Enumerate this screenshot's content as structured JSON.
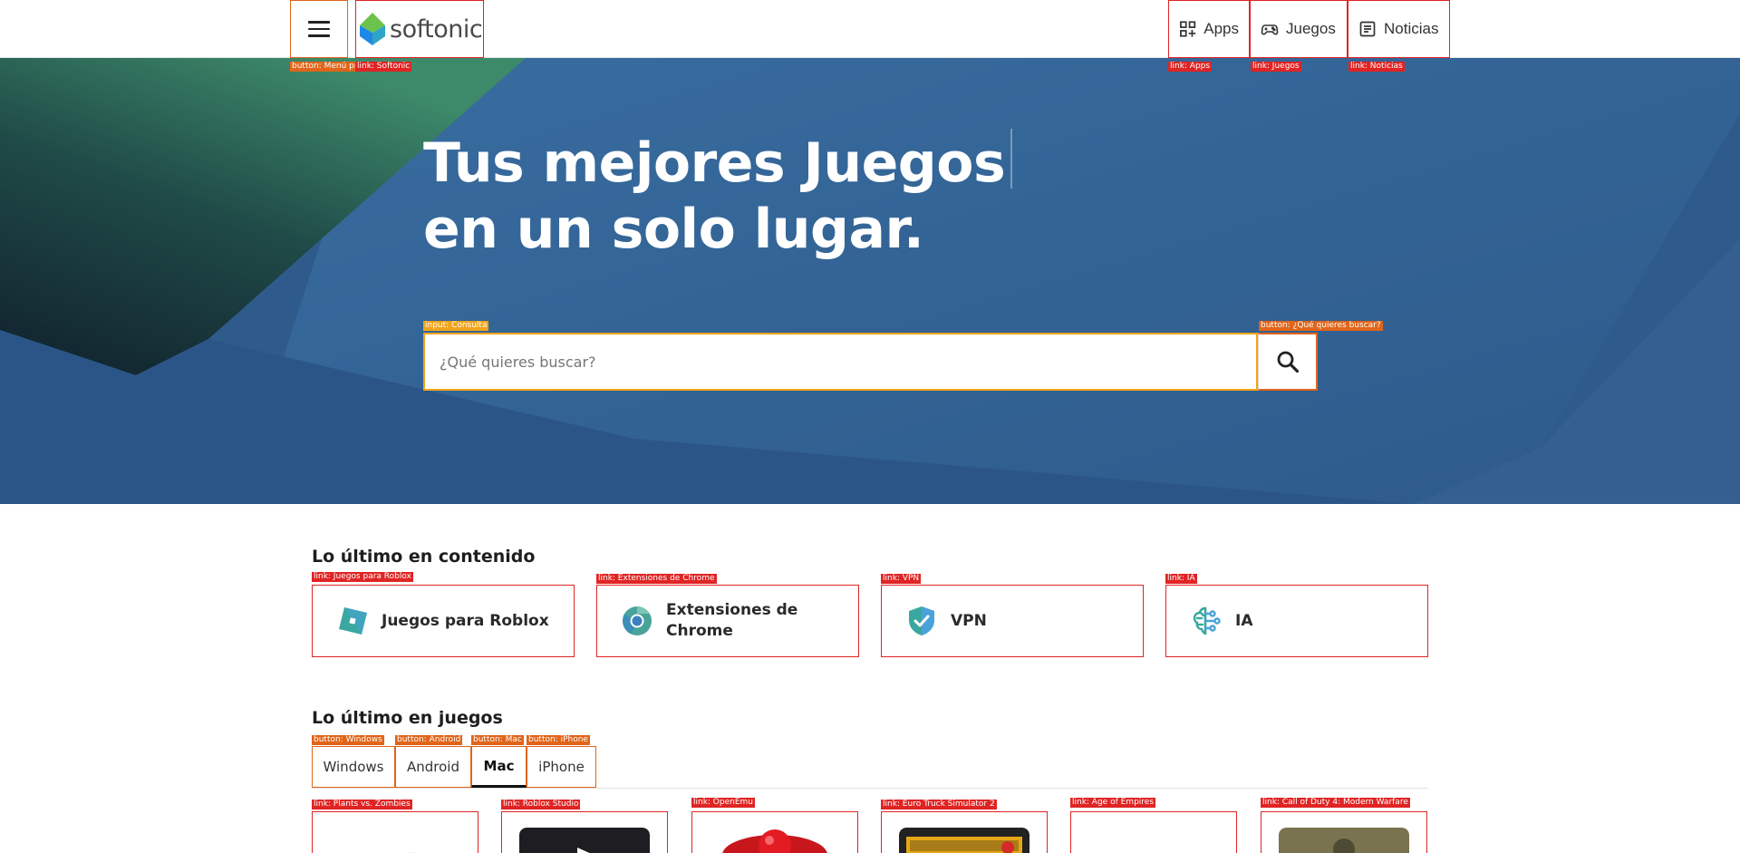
{
  "header": {
    "menu_label": "button: Menú principal",
    "logo_text": "softonic",
    "logo_tag": "link: Softonic",
    "nav": [
      {
        "label": "Apps",
        "tag": "link: Apps",
        "icon": "apps-grid-icon"
      },
      {
        "label": "Juegos",
        "tag": "link: Juegos",
        "icon": "gamepad-icon"
      },
      {
        "label": "Noticias",
        "tag": "link: Noticias",
        "icon": "news-icon"
      }
    ]
  },
  "hero": {
    "title_line1": "Tus mejores Juegos",
    "title_line2": "en un solo lugar.",
    "search_placeholder": "¿Qué quieres buscar?",
    "search_input_tag": "input: Consulta",
    "search_button_tag": "button: ¿Qué quieres buscar?"
  },
  "content_section": {
    "title": "Lo último en contenido",
    "cards": [
      {
        "label": "Juegos para Roblox",
        "tag": "link: Juegos para Roblox",
        "icon": "roblox-icon"
      },
      {
        "label": "Extensiones de Chrome",
        "tag": "link: Extensiones de Chrome",
        "icon": "chrome-icon"
      },
      {
        "label": "VPN",
        "tag": "link: VPN",
        "icon": "shield-icon"
      },
      {
        "label": "IA",
        "tag": "link: IA",
        "icon": "brain-icon"
      }
    ]
  },
  "games_section": {
    "title": "Lo último en juegos",
    "tabs": [
      {
        "label": "Windows",
        "tag": "button: Windows"
      },
      {
        "label": "Android",
        "tag": "button: Android"
      },
      {
        "label": "Mac",
        "tag": "button: Mac",
        "active": true
      },
      {
        "label": "iPhone",
        "tag": "button: iPhone"
      }
    ],
    "games": [
      {
        "tag": "link: Plants vs. Zombies"
      },
      {
        "tag": "link: Roblox Studio"
      },
      {
        "tag": "link: OpenEmu"
      },
      {
        "tag": "link: Euro Truck Simulator 2"
      },
      {
        "tag": "link: Age of Empires"
      },
      {
        "tag": "link: Call of Duty 4: Modern Warfare"
      }
    ]
  },
  "colors": {
    "hero_blue": "#2f5d8e",
    "accent_orange": "#e0651a",
    "annotation_red": "#e02424",
    "search_border": "#f0a41b"
  }
}
